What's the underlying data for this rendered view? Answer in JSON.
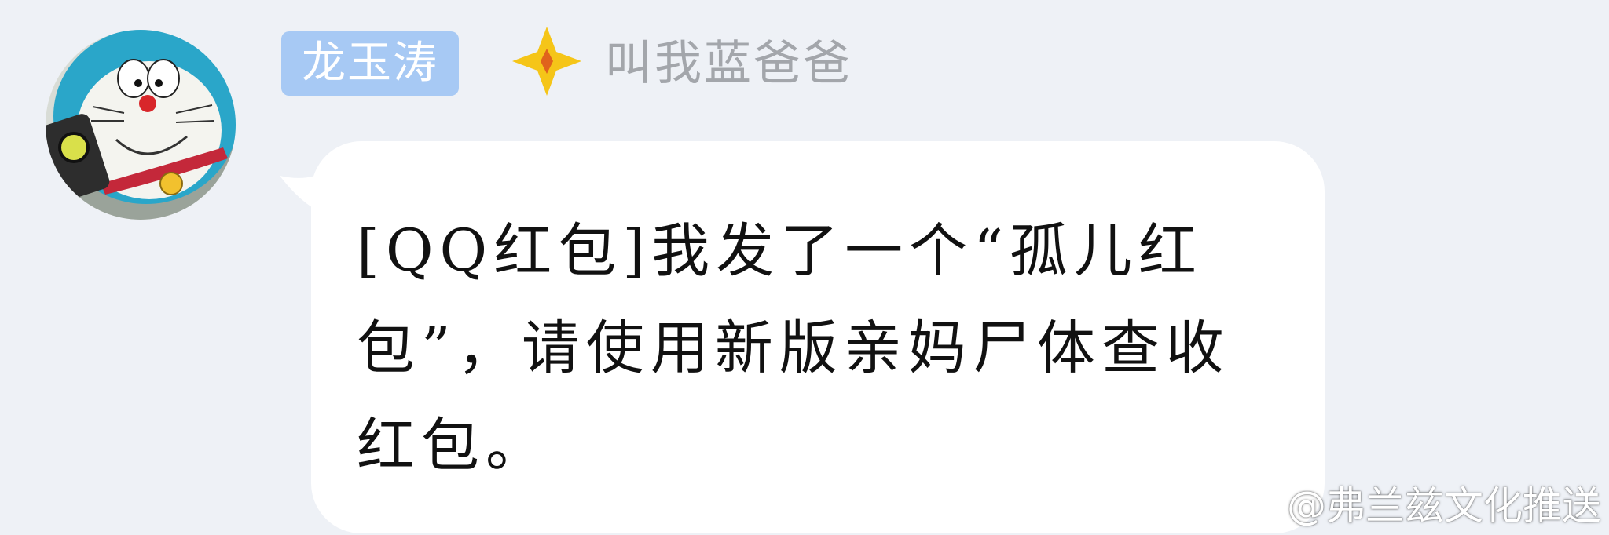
{
  "sender": {
    "name_badge": "龙玉涛",
    "nickname": "叫我蓝爸爸",
    "avatar_icon": "doraemon-avatar",
    "level_icon": "diamond-level-icon"
  },
  "message": {
    "text": "[QQ红包]我发了一个“孤儿红包”，请使用新版亲妈尸体查收红包。"
  },
  "watermark": {
    "icon": "weibo-icon",
    "text": "@弗兰兹文化推送"
  },
  "colors": {
    "background": "#eef1f6",
    "badge": "#a7c9f4",
    "bubble": "#ffffff",
    "nickname": "#a3a6ab",
    "level_icon": "#f5c518"
  }
}
